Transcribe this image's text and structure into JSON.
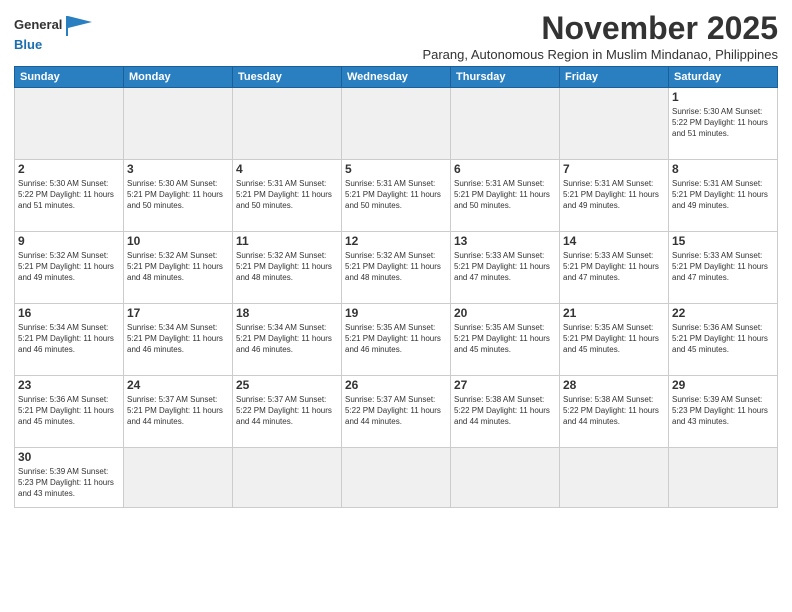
{
  "logo": {
    "line1": "General",
    "line2": "Blue"
  },
  "header": {
    "month": "November 2025",
    "subtitle": "Parang, Autonomous Region in Muslim Mindanao, Philippines"
  },
  "weekdays": [
    "Sunday",
    "Monday",
    "Tuesday",
    "Wednesday",
    "Thursday",
    "Friday",
    "Saturday"
  ],
  "weeks": [
    [
      {
        "day": "",
        "info": ""
      },
      {
        "day": "",
        "info": ""
      },
      {
        "day": "",
        "info": ""
      },
      {
        "day": "",
        "info": ""
      },
      {
        "day": "",
        "info": ""
      },
      {
        "day": "",
        "info": ""
      },
      {
        "day": "1",
        "info": "Sunrise: 5:30 AM\nSunset: 5:22 PM\nDaylight: 11 hours\nand 51 minutes."
      }
    ],
    [
      {
        "day": "2",
        "info": "Sunrise: 5:30 AM\nSunset: 5:22 PM\nDaylight: 11 hours\nand 51 minutes."
      },
      {
        "day": "3",
        "info": "Sunrise: 5:30 AM\nSunset: 5:21 PM\nDaylight: 11 hours\nand 50 minutes."
      },
      {
        "day": "4",
        "info": "Sunrise: 5:31 AM\nSunset: 5:21 PM\nDaylight: 11 hours\nand 50 minutes."
      },
      {
        "day": "5",
        "info": "Sunrise: 5:31 AM\nSunset: 5:21 PM\nDaylight: 11 hours\nand 50 minutes."
      },
      {
        "day": "6",
        "info": "Sunrise: 5:31 AM\nSunset: 5:21 PM\nDaylight: 11 hours\nand 50 minutes."
      },
      {
        "day": "7",
        "info": "Sunrise: 5:31 AM\nSunset: 5:21 PM\nDaylight: 11 hours\nand 49 minutes."
      },
      {
        "day": "8",
        "info": "Sunrise: 5:31 AM\nSunset: 5:21 PM\nDaylight: 11 hours\nand 49 minutes."
      }
    ],
    [
      {
        "day": "9",
        "info": "Sunrise: 5:32 AM\nSunset: 5:21 PM\nDaylight: 11 hours\nand 49 minutes."
      },
      {
        "day": "10",
        "info": "Sunrise: 5:32 AM\nSunset: 5:21 PM\nDaylight: 11 hours\nand 48 minutes."
      },
      {
        "day": "11",
        "info": "Sunrise: 5:32 AM\nSunset: 5:21 PM\nDaylight: 11 hours\nand 48 minutes."
      },
      {
        "day": "12",
        "info": "Sunrise: 5:32 AM\nSunset: 5:21 PM\nDaylight: 11 hours\nand 48 minutes."
      },
      {
        "day": "13",
        "info": "Sunrise: 5:33 AM\nSunset: 5:21 PM\nDaylight: 11 hours\nand 47 minutes."
      },
      {
        "day": "14",
        "info": "Sunrise: 5:33 AM\nSunset: 5:21 PM\nDaylight: 11 hours\nand 47 minutes."
      },
      {
        "day": "15",
        "info": "Sunrise: 5:33 AM\nSunset: 5:21 PM\nDaylight: 11 hours\nand 47 minutes."
      }
    ],
    [
      {
        "day": "16",
        "info": "Sunrise: 5:34 AM\nSunset: 5:21 PM\nDaylight: 11 hours\nand 46 minutes."
      },
      {
        "day": "17",
        "info": "Sunrise: 5:34 AM\nSunset: 5:21 PM\nDaylight: 11 hours\nand 46 minutes."
      },
      {
        "day": "18",
        "info": "Sunrise: 5:34 AM\nSunset: 5:21 PM\nDaylight: 11 hours\nand 46 minutes."
      },
      {
        "day": "19",
        "info": "Sunrise: 5:35 AM\nSunset: 5:21 PM\nDaylight: 11 hours\nand 46 minutes."
      },
      {
        "day": "20",
        "info": "Sunrise: 5:35 AM\nSunset: 5:21 PM\nDaylight: 11 hours\nand 45 minutes."
      },
      {
        "day": "21",
        "info": "Sunrise: 5:35 AM\nSunset: 5:21 PM\nDaylight: 11 hours\nand 45 minutes."
      },
      {
        "day": "22",
        "info": "Sunrise: 5:36 AM\nSunset: 5:21 PM\nDaylight: 11 hours\nand 45 minutes."
      }
    ],
    [
      {
        "day": "23",
        "info": "Sunrise: 5:36 AM\nSunset: 5:21 PM\nDaylight: 11 hours\nand 45 minutes."
      },
      {
        "day": "24",
        "info": "Sunrise: 5:37 AM\nSunset: 5:21 PM\nDaylight: 11 hours\nand 44 minutes."
      },
      {
        "day": "25",
        "info": "Sunrise: 5:37 AM\nSunset: 5:22 PM\nDaylight: 11 hours\nand 44 minutes."
      },
      {
        "day": "26",
        "info": "Sunrise: 5:37 AM\nSunset: 5:22 PM\nDaylight: 11 hours\nand 44 minutes."
      },
      {
        "day": "27",
        "info": "Sunrise: 5:38 AM\nSunset: 5:22 PM\nDaylight: 11 hours\nand 44 minutes."
      },
      {
        "day": "28",
        "info": "Sunrise: 5:38 AM\nSunset: 5:22 PM\nDaylight: 11 hours\nand 44 minutes."
      },
      {
        "day": "29",
        "info": "Sunrise: 5:39 AM\nSunset: 5:23 PM\nDaylight: 11 hours\nand 43 minutes."
      }
    ],
    [
      {
        "day": "30",
        "info": "Sunrise: 5:39 AM\nSunset: 5:23 PM\nDaylight: 11 hours\nand 43 minutes."
      },
      {
        "day": "",
        "info": ""
      },
      {
        "day": "",
        "info": ""
      },
      {
        "day": "",
        "info": ""
      },
      {
        "day": "",
        "info": ""
      },
      {
        "day": "",
        "info": ""
      },
      {
        "day": "",
        "info": ""
      }
    ]
  ]
}
